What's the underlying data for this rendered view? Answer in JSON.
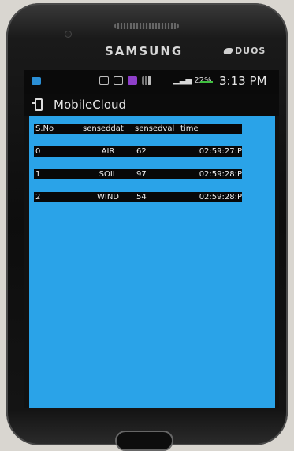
{
  "device": {
    "brand": "SAMSUNG",
    "model_badge": "DUOS"
  },
  "status_bar": {
    "battery": "22%",
    "time": "3:13 PM"
  },
  "app": {
    "title": "MobileCloud"
  },
  "table": {
    "headers": [
      "S.No",
      "senseddat",
      "sensedval",
      "time"
    ],
    "rows": [
      [
        "0",
        "AIR",
        "62",
        "02:59:27:P"
      ],
      [
        "1",
        "SOIL",
        "97",
        "02:59:28:P"
      ],
      [
        "2",
        "WIND",
        "54",
        "02:59:28:P"
      ]
    ]
  },
  "colors": {
    "content_bg": "#2aa3e8",
    "row_bg": "#080808"
  }
}
